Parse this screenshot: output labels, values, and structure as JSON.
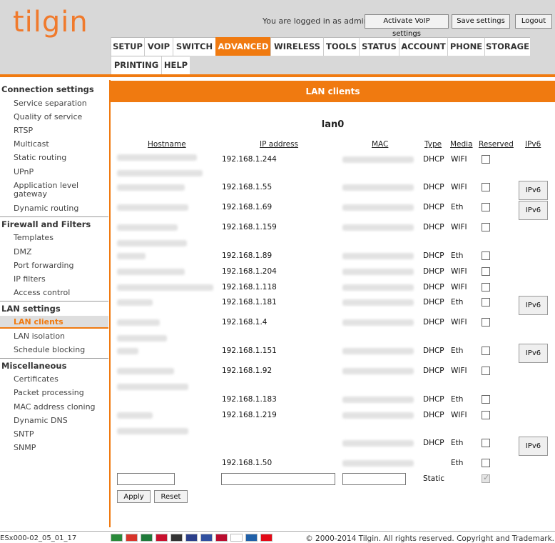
{
  "header": {
    "logo": "tilgin",
    "login_text": "You are logged in as admin.",
    "buttons": [
      "Activate VoIP settings",
      "Save settings",
      "Logout"
    ]
  },
  "tabs": [
    "SETUP",
    "VOIP",
    "SWITCH",
    "ADVANCED",
    "WIRELESS",
    "TOOLS",
    "STATUS",
    "ACCOUNT",
    "PHONE",
    "STORAGE",
    "PRINTING",
    "HELP"
  ],
  "active_tab": "ADVANCED",
  "sidebar": {
    "sections": [
      {
        "title": "Connection settings",
        "items": [
          "Service separation",
          "Quality of service",
          "RTSP",
          "Multicast",
          "Static routing",
          "UPnP",
          "Application level gateway",
          "Dynamic routing"
        ]
      },
      {
        "title": "Firewall and Filters",
        "items": [
          "Templates",
          "DMZ",
          "Port forwarding",
          "IP filters",
          "Access control"
        ]
      },
      {
        "title": "LAN settings",
        "items": [
          "LAN clients",
          "LAN isolation",
          "Schedule blocking"
        ]
      },
      {
        "title": "Miscellaneous",
        "items": [
          "Certificates",
          "Packet processing",
          "MAC address cloning",
          "Dynamic DNS",
          "SNTP",
          "SNMP"
        ]
      }
    ],
    "active_item": "LAN clients"
  },
  "content": {
    "title": "LAN clients",
    "interface": "lan0",
    "columns": [
      "Hostname",
      "IP address",
      "MAC",
      "Type",
      "Media",
      "Reserved",
      "IPv6"
    ],
    "rows": [
      {
        "ip": "192.168.1.244",
        "type": "DHCP",
        "media": "WIFI",
        "reserved": false,
        "ipv6": false
      },
      {
        "ip": "192.168.1.55",
        "type": "DHCP",
        "media": "WIFI",
        "reserved": false,
        "ipv6": true
      },
      {
        "ip": "192.168.1.69",
        "type": "DHCP",
        "media": "Eth",
        "reserved": false,
        "ipv6": true
      },
      {
        "ip": "192.168.1.159",
        "type": "DHCP",
        "media": "WIFI",
        "reserved": false,
        "ipv6": false
      },
      {
        "ip": "192.168.1.89",
        "type": "DHCP",
        "media": "Eth",
        "reserved": false,
        "ipv6": false
      },
      {
        "ip": "192.168.1.204",
        "type": "DHCP",
        "media": "WIFI",
        "reserved": false,
        "ipv6": false
      },
      {
        "ip": "192.168.1.118",
        "type": "DHCP",
        "media": "WIFI",
        "reserved": false,
        "ipv6": false
      },
      {
        "ip": "192.168.1.181",
        "type": "DHCP",
        "media": "Eth",
        "reserved": false,
        "ipv6": true
      },
      {
        "ip": "192.168.1.4",
        "type": "DHCP",
        "media": "WIFI",
        "reserved": false,
        "ipv6": false
      },
      {
        "ip": "192.168.1.151",
        "type": "DHCP",
        "media": "Eth",
        "reserved": false,
        "ipv6": true
      },
      {
        "ip": "192.168.1.92",
        "type": "DHCP",
        "media": "WIFI",
        "reserved": false,
        "ipv6": false
      },
      {
        "ip": "192.168.1.183",
        "type": "DHCP",
        "media": "Eth",
        "reserved": false,
        "ipv6": false
      },
      {
        "ip": "192.168.1.219",
        "type": "DHCP",
        "media": "WIFI",
        "reserved": false,
        "ipv6": false
      },
      {
        "ip": "",
        "type": "DHCP",
        "media": "Eth",
        "reserved": false,
        "ipv6": true
      },
      {
        "ip": "192.168.1.50",
        "type": "",
        "media": "Eth",
        "reserved": false,
        "ipv6": false
      }
    ],
    "ipv6_label": "IPv6",
    "new_row": {
      "type": "Static",
      "reserved": true,
      "hostname_value": "",
      "ip_value": "",
      "mac_value": ""
    },
    "apply_label": "Apply",
    "reset_label": "Reset"
  },
  "footer": {
    "firmware": "ESx000-02_05_01_17",
    "copyright": "© 2000-2014 Tilgin. All rights reserved. Copyright and Trademark.",
    "languages": [
      "ar",
      "zh",
      "sa",
      "dk",
      "de",
      "en",
      "fr",
      "no",
      "ru",
      "se",
      "tr"
    ]
  },
  "colors": {
    "accent": "#f07a10",
    "header_bg": "#d8d8d8",
    "active_bg": "#dedede"
  }
}
